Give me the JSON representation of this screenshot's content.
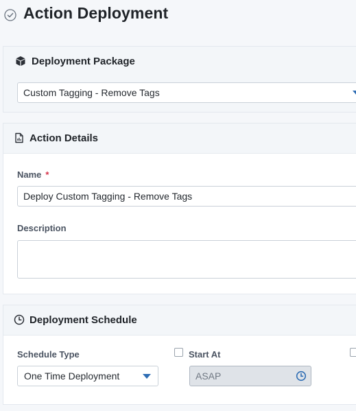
{
  "page": {
    "title": "Action Deployment"
  },
  "deployment_package": {
    "heading": "Deployment Package",
    "selected": "Custom Tagging - Remove Tags"
  },
  "action_details": {
    "heading": "Action Details",
    "name_label": "Name",
    "required_mark": "*",
    "name_value": "Deploy Custom Tagging - Remove Tags",
    "description_label": "Description",
    "description_value": ""
  },
  "deployment_schedule": {
    "heading": "Deployment Schedule",
    "schedule_type_label": "Schedule Type",
    "schedule_type_value": "One Time Deployment",
    "start_at_label": "Start At",
    "start_at_value": "ASAP",
    "start_at_checked": false,
    "extra_option_checked": false
  },
  "colors": {
    "accent": "#2e6db4",
    "required": "#d6334a",
    "panel_header_bg": "#f3f6f9",
    "disabled_input_bg": "#dfe3e8"
  },
  "icons": {
    "title": "check-circle-icon",
    "package": "cube-icon",
    "details": "document-icon",
    "schedule": "clock-icon",
    "start_at_picker": "clock-icon"
  }
}
